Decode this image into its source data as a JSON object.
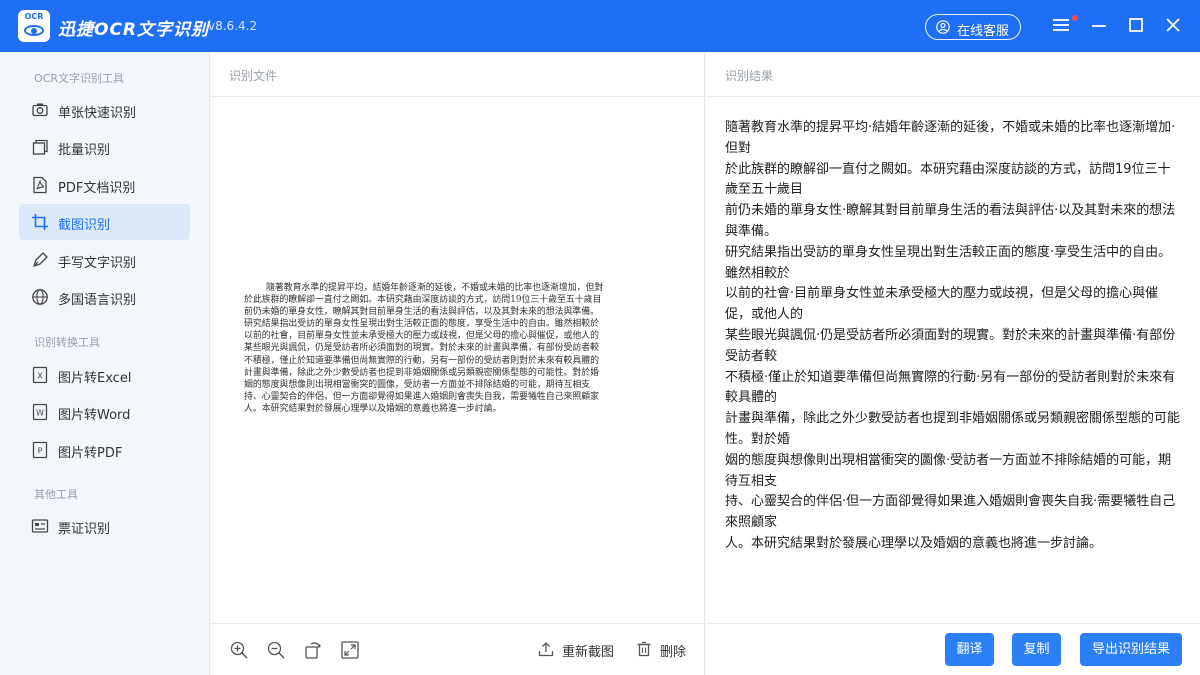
{
  "app": {
    "logo_text": "OCR",
    "title": "迅捷OCR文字识别",
    "version": "v8.6.4.2",
    "service_button": "在线客服"
  },
  "sidebar": {
    "sections": [
      {
        "title": "OCR文字识别工具"
      },
      {
        "title": "识别转换工具"
      },
      {
        "title": "其他工具"
      }
    ],
    "items": [
      {
        "label": "单张快速识别",
        "icon": "camera-icon"
      },
      {
        "label": "批量识别",
        "icon": "stack-icon"
      },
      {
        "label": "PDF文档识别",
        "icon": "pdf-file-icon"
      },
      {
        "label": "截图识别",
        "icon": "crop-icon",
        "active": true
      },
      {
        "label": "手写文字识别",
        "icon": "pen-icon"
      },
      {
        "label": "多国语言识别",
        "icon": "globe-icon"
      },
      {
        "label": "图片转Excel",
        "icon": "excel-icon"
      },
      {
        "label": "图片转Word",
        "icon": "word-icon"
      },
      {
        "label": "图片转PDF",
        "icon": "pdf-icon"
      },
      {
        "label": "票证识别",
        "icon": "ticket-icon"
      }
    ]
  },
  "left_panel": {
    "header": "识别文件",
    "document_lines": [
      "隨著教育水準的提昇平均，結婚年齡逐漸的延後，不婚或未婚的比率也逐漸增加，但對",
      "於此族群的瞭解卻一直付之闕如。本研究藉由深度訪談的方式，訪問19位三十歲至五十歲目",
      "前仍未婚的單身女性，瞭解其對目前單身生活的看法與評估，以及其對未來的想法與準備。",
      "研究結果指出受訪的單身女性呈現出對生活較正面的態度，享受生活中的自由。雖然相較於",
      "以前的社會，目前單身女性並未承受極大的壓力或歧視，但是父母的擔心與催促，或他人的",
      "某些眼光與諷侃，仍是受訪者所必須面對的現實。對於未來的計畫與準備，有部份受訪者較",
      "不積極，僅止於知道要準備但尚無實際的行動，另有一部份的受訪者則對於未來有較具體的",
      "計畫與準備，除此之外少數受訪者也提到非婚姻關係或另類親密關係型態的可能性。對於婚",
      "姻的態度與想像則出現相當衝突的圖像，受訪者一方面並不排除結婚的可能，期待互相支",
      "持、心靈契合的伴侶，但一方面卻覺得如果進入婚姻則會喪失自我，需要犧牲自己來照顧家",
      "人。本研究結果對於發展心理學以及婚姻的意義也將進一步討論。"
    ],
    "toolbar": {
      "zoom_in_icon": "zoom-in-icon",
      "zoom_out_icon": "zoom-out-icon",
      "rotate_icon": "rotate-icon",
      "fit_icon": "fit-screen-icon",
      "recapture_label": "重新截图",
      "delete_label": "删除"
    }
  },
  "right_panel": {
    "header": "识别结果",
    "result_lines": [
      "隨著教育水準的提昇平均·結婚年齡逐漸的延後，不婚或未婚的比率也逐漸增加·但對",
      "於此族群的瞭解卻一直付之闕如。本研究藉由深度訪談的方式，訪問19位三十歲至五十歲目",
      "前仍未婚的單身女性·瞭解其對目前單身生活的看法與評估·以及其對未來的想法與準備。",
      "研究結果指出受訪的單身女性呈現出對生活較正面的態度·享受生活中的自由。雖然相較於",
      "以前的社會·目前單身女性並未承受極大的壓力或歧視，但是父母的擔心與催促，或他人的",
      "某些眼光與諷侃·仍是受訪者所必須面對的現實。對於未來的計畫與準備·有部份受訪者較",
      "不積極·僅止於知道要準備但尚無實際的行動·另有一部份的受訪者則對於未來有較具體的",
      "計畫與準備，除此之外少數受訪者也提到非婚姻關係或另類親密關係型態的可能性。對於婚",
      "姻的態度與想像則出現相當衝突的圖像·受訪者一方面並不排除結婚的可能，期待互相支",
      "持、心靈契合的伴侶·但一方面卻覺得如果進入婚姻則會喪失自我·需要犧牲自己來照顧家",
      "人。本研究結果對於發展心理學以及婚姻的意義也將進一步討論。"
    ],
    "buttons": {
      "translate": "翻译",
      "copy": "复制",
      "export": "导出识别结果"
    }
  },
  "colors": {
    "primary": "#1f6ff6",
    "button": "#2b80f7",
    "sidebar_bg": "#f3f6fb",
    "active_item_bg": "#dde8f8"
  }
}
